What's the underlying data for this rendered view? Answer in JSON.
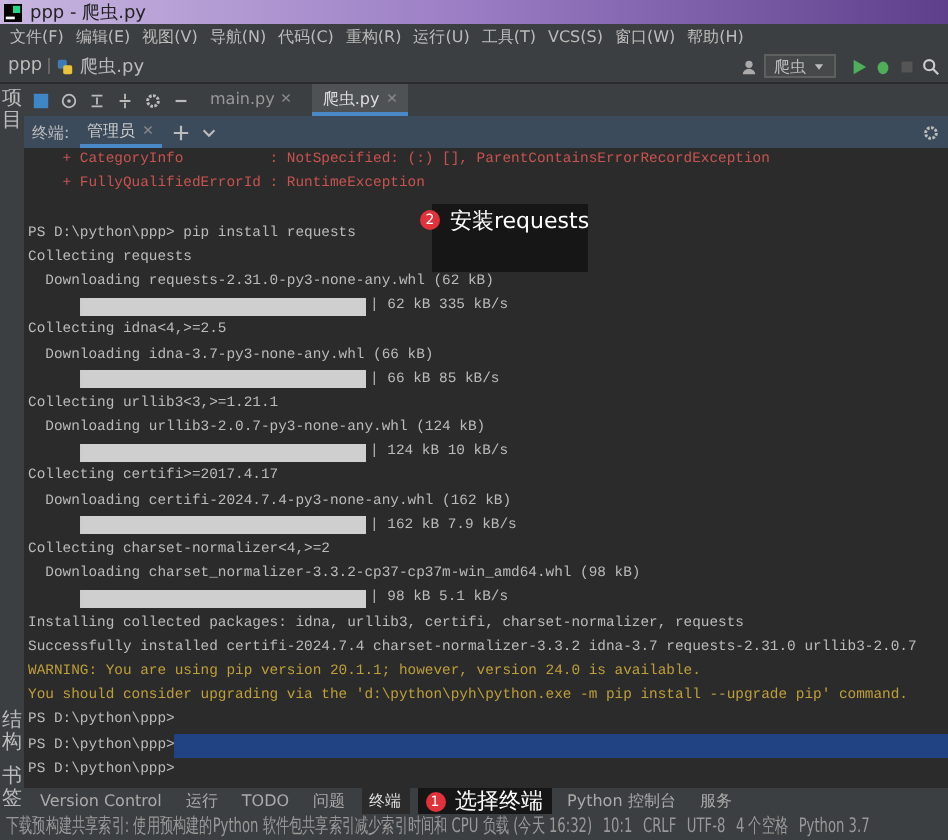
{
  "window": {
    "title": "ppp - 爬虫.py"
  },
  "menu": [
    "文件(F)",
    "编辑(E)",
    "视图(V)",
    "导航(N)",
    "代码(C)",
    "重构(R)",
    "运行(U)",
    "工具(T)",
    "VCS(S)",
    "窗口(W)",
    "帮助(H)"
  ],
  "breadcrumb": [
    "ppp",
    "爬虫.py"
  ],
  "run_config": "爬虫",
  "left_stripe": {
    "top": "项目",
    "bottom": [
      "结构",
      "书签"
    ]
  },
  "editor_tabs": [
    {
      "label": "main.py",
      "selected": false
    },
    {
      "label": "爬虫.py",
      "selected": true
    }
  ],
  "terminal": {
    "label": "终端:",
    "tabs": [
      {
        "label": "管理员",
        "selected": true
      }
    ],
    "lines": [
      {
        "kind": "error",
        "text": "    + CategoryInfo          : NotSpecified: (:) [], ParentContainsErrorRecordException"
      },
      {
        "kind": "error",
        "text": "    + FullyQualifiedErrorId : RuntimeException"
      },
      {
        "kind": "blank"
      },
      {
        "kind": "text",
        "text": "PS D:\\python\\ppp> pip install requests"
      },
      {
        "kind": "text",
        "text": "Collecting requests"
      },
      {
        "kind": "text",
        "text": "  Downloading requests-2.31.0-py3-none-any.whl (62 kB)"
      },
      {
        "kind": "progress",
        "level": 1,
        "text": "| 62 kB 335 kB/s"
      },
      {
        "kind": "text",
        "text": "Collecting idna<4,>=2.5"
      },
      {
        "kind": "text",
        "text": "  Downloading idna-3.7-py3-none-any.whl (66 kB)"
      },
      {
        "kind": "progress",
        "level": 1,
        "text": "| 66 kB 85 kB/s"
      },
      {
        "kind": "text",
        "text": "Collecting urllib3<3,>=1.21.1"
      },
      {
        "kind": "text",
        "text": "  Downloading urllib3-2.0.7-py3-none-any.whl (124 kB)"
      },
      {
        "kind": "progress",
        "level": 1,
        "text": "| 124 kB 10 kB/s"
      },
      {
        "kind": "text",
        "text": "Collecting certifi>=2017.4.17"
      },
      {
        "kind": "text",
        "text": "  Downloading certifi-2024.7.4-py3-none-any.whl (162 kB)"
      },
      {
        "kind": "progress",
        "level": 1,
        "text": "| 162 kB 7.9 kB/s"
      },
      {
        "kind": "text",
        "text": "Collecting charset-normalizer<4,>=2"
      },
      {
        "kind": "text",
        "text": "  Downloading charset_normalizer-3.3.2-cp37-cp37m-win_amd64.whl (98 kB)"
      },
      {
        "kind": "progress",
        "level": 1,
        "text": "| 98 kB 5.1 kB/s"
      },
      {
        "kind": "text",
        "text": "Installing collected packages: idna, urllib3, certifi, charset-normalizer, requests"
      },
      {
        "kind": "text",
        "text": "Successfully installed certifi-2024.7.4 charset-normalizer-3.3.2 idna-3.7 requests-2.31.0 urllib3-2.0.7"
      },
      {
        "kind": "warning",
        "text": "WARNING: You are using pip version 20.1.1; however, version 24.0 is available."
      },
      {
        "kind": "warning",
        "text": "You should consider upgrading via the 'd:\\python\\pyh\\python.exe -m pip install --upgrade pip' command."
      },
      {
        "kind": "text",
        "text": "PS D:\\python\\ppp>"
      },
      {
        "kind": "prompt",
        "text": "PS D:\\python\\ppp>",
        "selected": true
      },
      {
        "kind": "prompt",
        "text": "PS D:\\python\\ppp>",
        "selected": false
      }
    ]
  },
  "callouts": [
    {
      "badge": "2",
      "text": "安装requests",
      "kind": "terminal"
    },
    {
      "badge": "1",
      "text": "选择终端",
      "kind": "toolbar"
    }
  ],
  "tool_buttons": [
    {
      "label": "Version Control",
      "selected": false
    },
    {
      "label": "运行",
      "selected": false
    },
    {
      "label": "TODO",
      "selected": false
    },
    {
      "label": "问题",
      "selected": false
    },
    {
      "label": "终端",
      "selected": true
    },
    {
      "label": "Python 控制台",
      "selected": false
    },
    {
      "label": "服务",
      "selected": false
    }
  ],
  "status_bar": {
    "message": "下载预构建共享索引: 使用预构建的Python 软件包共享索引减少索引时间和 CPU 负载 (今天 16:32)",
    "position": "10:1",
    "line_sep": "CRLF",
    "encoding": "UTF-8",
    "indent": "4 个空格",
    "interpreter": "Python 3.7"
  }
}
